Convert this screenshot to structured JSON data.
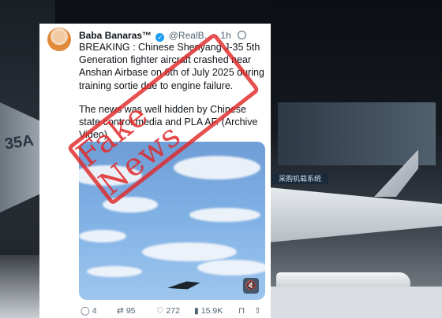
{
  "tweet": {
    "display_name": "Baba Banaras™",
    "verified_badge": "✓",
    "handle": "@RealB...",
    "separator": "·",
    "time": "1h",
    "paragraph1": "BREAKING : Chinese Shenyang J-35 5th Generation fighter aircraft crashed near Anshan Airbase on 6th of July 2025 during training sortie due to engine failure.",
    "paragraph2": "The news was well hidden by Chinese state control media and PLA AF. (Archive Video)"
  },
  "media": {
    "mute_icon": "speaker-muted-icon",
    "mute_glyph": "🔇"
  },
  "actions": {
    "replies": "4",
    "retweets": "95",
    "likes": "272",
    "views": "15.9K",
    "reply_glyph": "◯",
    "retweet_glyph": "⇄",
    "like_glyph": "♡",
    "views_glyph": "▮",
    "bookmark_glyph": "⊓",
    "share_glyph": "⇧"
  },
  "stamp": {
    "text": "Fake News",
    "color": "#e12828"
  },
  "background": {
    "jet_label": "35A",
    "sign_text": "采购机载系统"
  }
}
